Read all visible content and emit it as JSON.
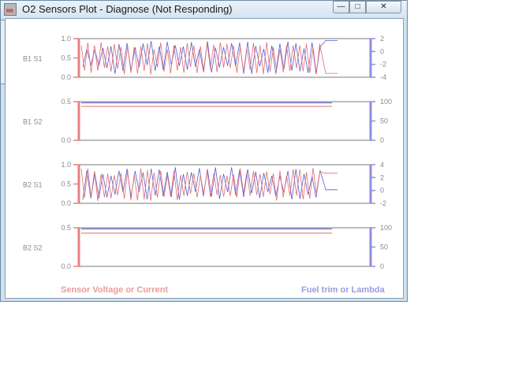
{
  "window": {
    "title": "O2 Sensors Plot - Diagnose (Not Responding)",
    "app_icon_text": "RR",
    "controls": {
      "minimize": "—",
      "maximize": "□",
      "close": "✕"
    }
  },
  "colors": {
    "sensor_trace": "#e06c6c",
    "fuel_trim_trace": "#5a5ad6",
    "left_axis": "#e88080",
    "right_axis": "#8f8fe2",
    "frame": "#7a7a7a",
    "tick_text": "#8a8a8a"
  },
  "legend": {
    "left": "Sensor Voltage or Current",
    "right": "Fuel trim or Lambda"
  },
  "chart_data": [
    {
      "type": "line",
      "label": "B1 S1",
      "left_ticks": [
        "1.0",
        "0.5",
        "0.0"
      ],
      "left_ylim": [
        0,
        1
      ],
      "right_ticks": [
        "2",
        "0",
        "-2",
        "-4"
      ],
      "right_ylim": [
        -4,
        2
      ],
      "pattern": "oscillating",
      "sensor_final": 0.1,
      "trim_final": 0.95
    },
    {
      "type": "line",
      "label": "B1 S2",
      "left_ticks": [
        "0.5",
        "0.0"
      ],
      "left_ylim": [
        0,
        0.5
      ],
      "right_ticks": [
        "100",
        "50",
        "0"
      ],
      "right_ylim": [
        0,
        100
      ],
      "pattern": "flat",
      "sensor_level": 0.47,
      "trim_level": 0.49
    },
    {
      "type": "line",
      "label": "B2 S1",
      "left_ticks": [
        "1.0",
        "0.5",
        "0.0"
      ],
      "left_ylim": [
        0,
        1
      ],
      "right_ticks": [
        "4",
        "2",
        "0",
        "-2"
      ],
      "right_ylim": [
        -2,
        4
      ],
      "pattern": "oscillating",
      "sensor_final": 0.78,
      "trim_final": 0.35
    },
    {
      "type": "line",
      "label": "B2 S2",
      "left_ticks": [
        "0.5",
        "0.0"
      ],
      "left_ylim": [
        0,
        0.5
      ],
      "right_ticks": [
        "100",
        "50",
        "0"
      ],
      "right_ylim": [
        0,
        100
      ],
      "pattern": "flat",
      "sensor_level": 0.46,
      "trim_level": 0.49
    }
  ]
}
